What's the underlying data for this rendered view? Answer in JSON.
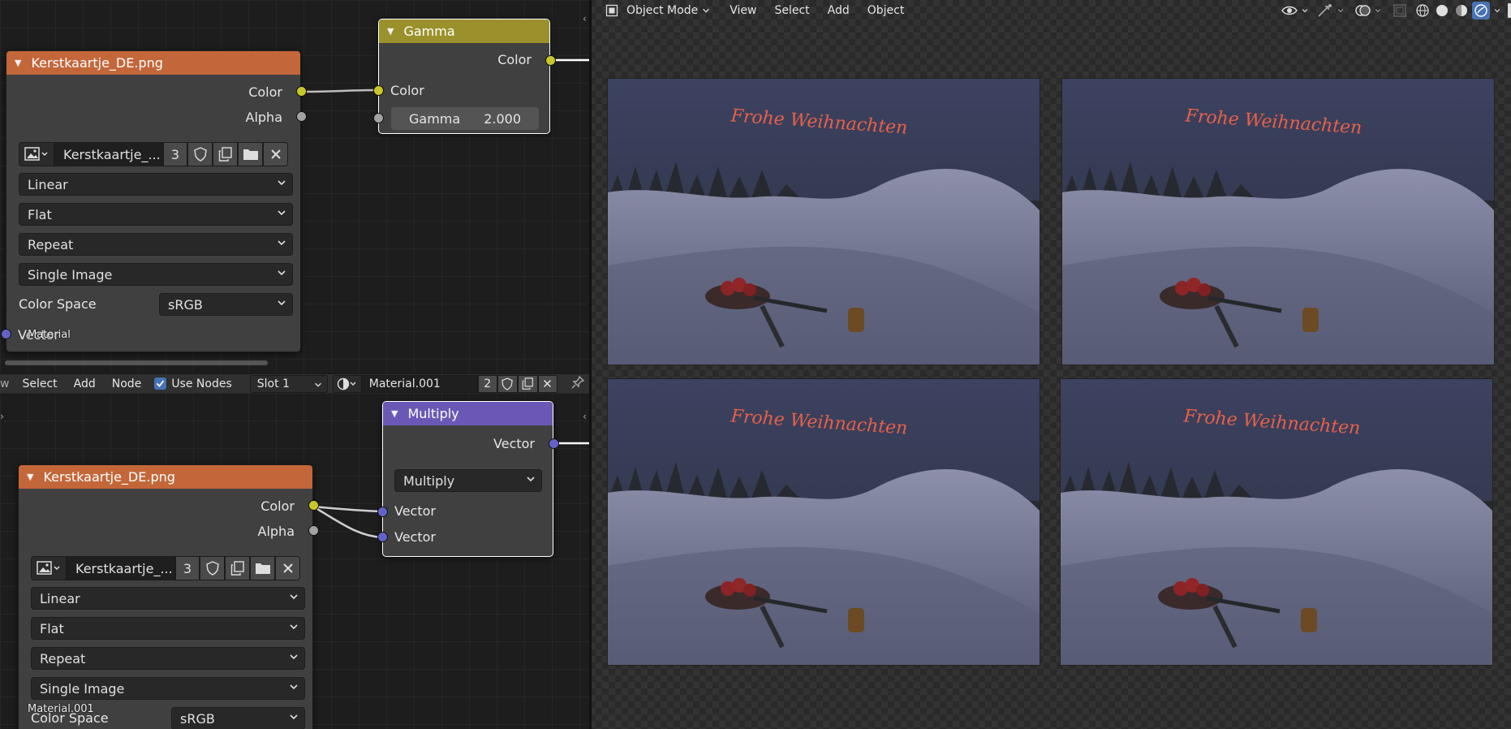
{
  "top_editor": {
    "image_node": {
      "title": "Kerstkaartje_DE.png",
      "outputs": [
        "Color",
        "Alpha"
      ],
      "image_name": "Kerstkaartje_...",
      "users": "3",
      "interpolation": "Linear",
      "projection": "Flat",
      "extension": "Repeat",
      "source": "Single Image",
      "color_space_label": "Color Space",
      "color_space": "sRGB",
      "vector_label": "Vector"
    },
    "gamma_node": {
      "title": "Gamma",
      "output": "Color",
      "input_color": "Color",
      "gamma_label": "Gamma",
      "gamma_value": "2.000"
    },
    "editor_label": "Material"
  },
  "header": {
    "menus": [
      "Select",
      "Add",
      "Node"
    ],
    "use_nodes": "Use Nodes",
    "slot": "Slot 1",
    "material": "Material.001",
    "users": "2"
  },
  "bottom_editor": {
    "multiply_node": {
      "title": "Multiply",
      "output": "Vector",
      "operation": "Multiply",
      "input1": "Vector",
      "input2": "Vector"
    },
    "image_node": {
      "title": "Kerstkaartje_DE.png",
      "outputs": [
        "Color",
        "Alpha"
      ],
      "image_name": "Kerstkaartje_...",
      "users": "3",
      "interpolation": "Linear",
      "projection": "Flat",
      "extension": "Repeat",
      "source": "Single Image",
      "color_space_label": "Color Space",
      "color_space": "sRGB"
    },
    "editor_label": "Material.001"
  },
  "viewport": {
    "mode": "Object Mode",
    "menus": [
      "View",
      "Select",
      "Add",
      "Object"
    ],
    "render_text": "Frohe Weihnachten",
    "panel_count": 4
  },
  "colors": {
    "texture_header": "#c3673a",
    "gamma_header": "#9b912c",
    "vector_header": "#6b58b6",
    "socket_color": "#c7c729",
    "socket_vector": "#6363c7",
    "accent": "#4772b3"
  }
}
